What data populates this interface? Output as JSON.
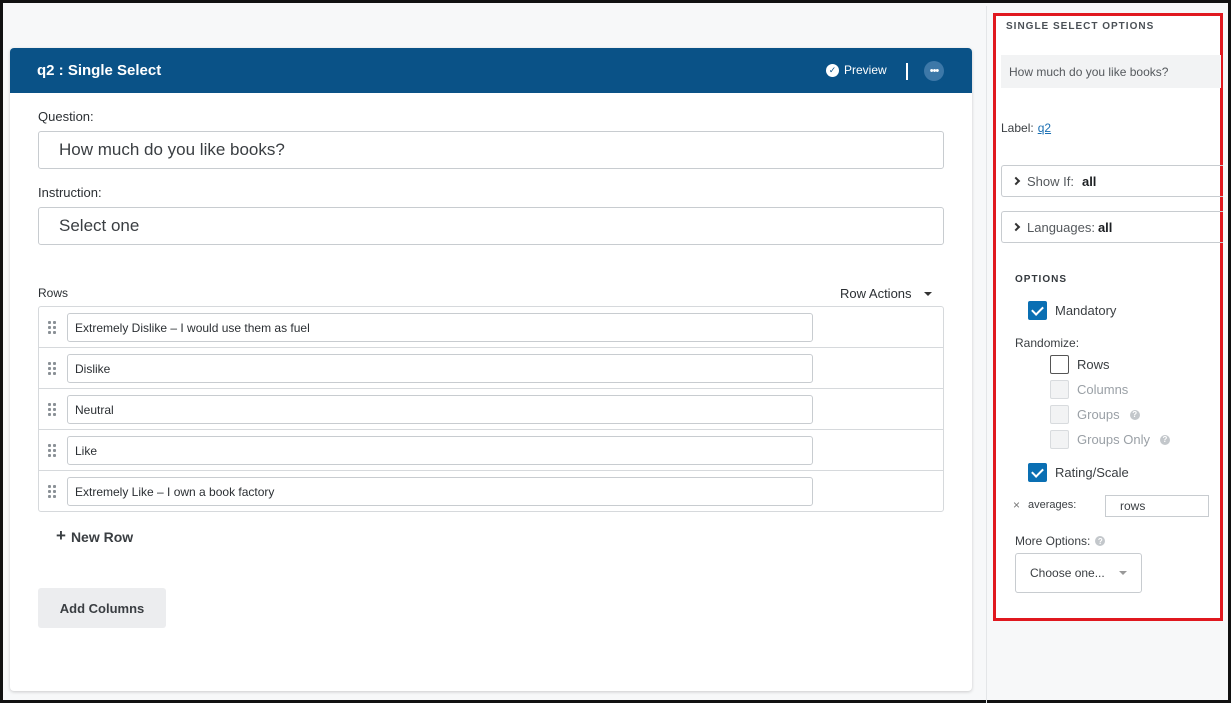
{
  "editor": {
    "title": "q2 : Single Select",
    "preview_label": "Preview",
    "more_label": "•••",
    "question_label": "Question:",
    "question_value": "How much do you like books?",
    "instruction_label": "Instruction:",
    "instruction_value": "Select one",
    "rows_label": "Rows",
    "row_actions_label": "Row Actions",
    "rows": [
      {
        "value": "Extremely Dislike – I would use them as fuel"
      },
      {
        "value": "Dislike"
      },
      {
        "value": "Neutral"
      },
      {
        "value": "Like"
      },
      {
        "value": "Extremely Like – I own a book factory"
      }
    ],
    "new_row_label": "New Row",
    "add_columns_label": "Add Columns"
  },
  "side": {
    "title": "SINGLE SELECT OPTIONS",
    "question_text": "How much do you like books?",
    "label_prefix": "Label:",
    "label_value": "q2",
    "show_if_label": "Show If:",
    "show_if_value": "all",
    "languages_label": "Languages:",
    "languages_value": "all",
    "options_title": "OPTIONS",
    "mandatory_label": "Mandatory",
    "mandatory_checked": true,
    "randomize_label": "Randomize:",
    "randomize": {
      "rows": "Rows",
      "columns": "Columns",
      "groups": "Groups",
      "groups_only": "Groups Only"
    },
    "rating_scale_label": "Rating/Scale",
    "rating_scale_checked": true,
    "averages_label": "averages:",
    "averages_value": "rows",
    "more_options_label": "More Options:",
    "more_options_select": "Choose one..."
  },
  "colors": {
    "header_blue": "#0a5287",
    "checkbox_blue": "#0a6fb3",
    "highlight_red": "#e0181f"
  }
}
